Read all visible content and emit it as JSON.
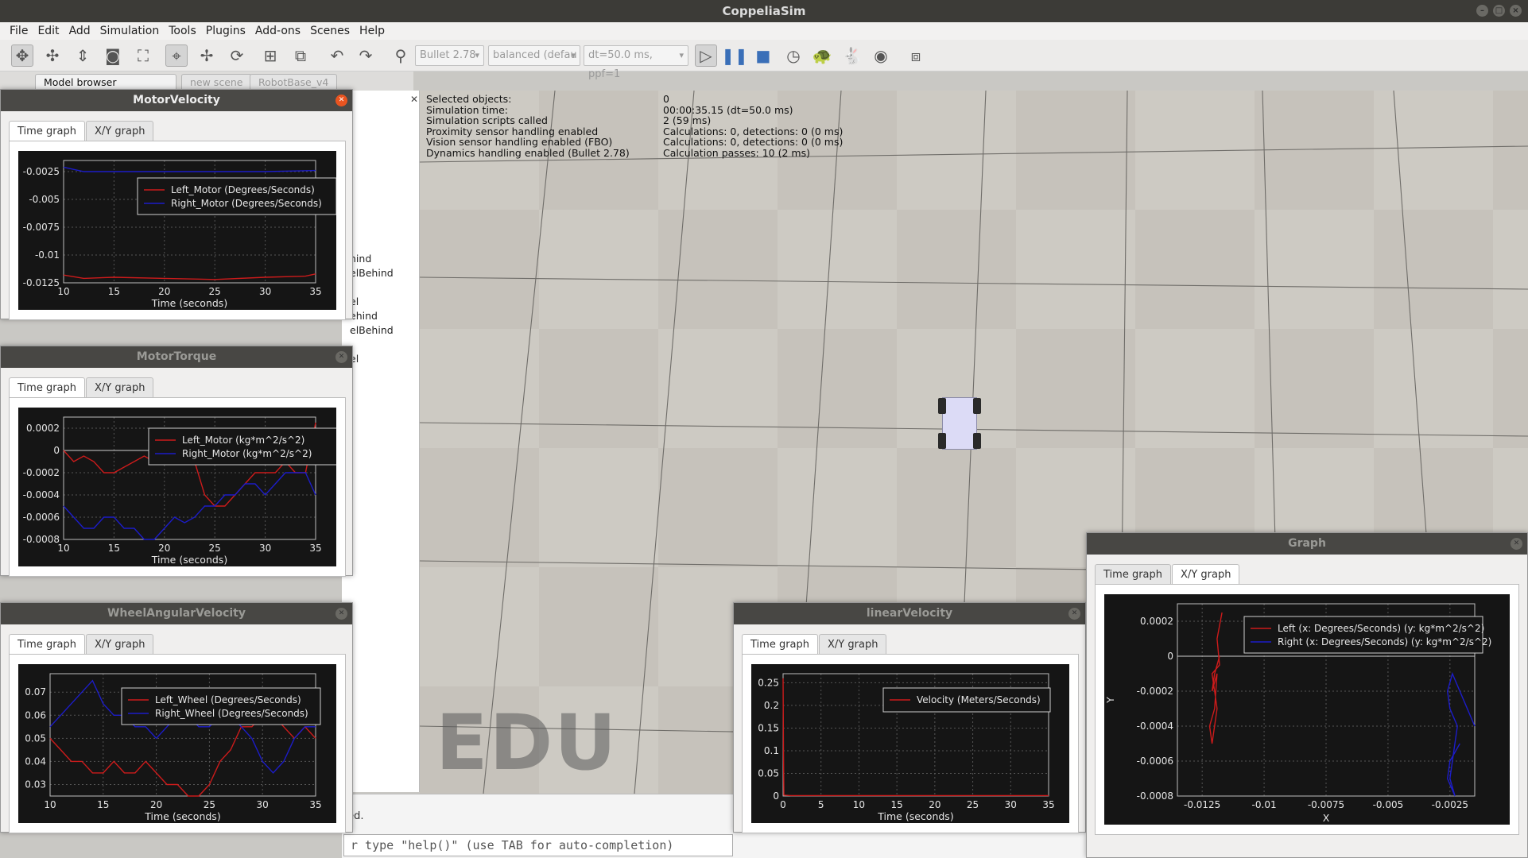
{
  "window": {
    "title": "CoppeliaSim"
  },
  "menu": [
    "File",
    "Edit",
    "Add",
    "Simulation",
    "Tools",
    "Plugins",
    "Add-ons",
    "Scenes",
    "Help"
  ],
  "toolbar": {
    "engine": "Bullet 2.78",
    "accuracy": "balanced (defau",
    "timestep": "dt=50.0 ms, ppf=1"
  },
  "tabs": {
    "model_browser": "Model browser",
    "new_scene": "new scene",
    "scene2": "RobotBase_v4"
  },
  "hierarchy": [
    "hind",
    "elBehind",
    "el",
    "ehind",
    "elBehind",
    "el"
  ],
  "sim_info": [
    {
      "k": "Selected objects:",
      "v": "0"
    },
    {
      "k": "Simulation time:",
      "v": "00:00:35.15 (dt=50.0 ms)"
    },
    {
      "k": "Simulation scripts called",
      "v": "2 (59 ms)"
    },
    {
      "k": "Proximity sensor handling enabled",
      "v": "Calculations: 0, detections: 0 (0 ms)"
    },
    {
      "k": "Vision sensor handling enabled (FBO)",
      "v": "Calculations: 0, detections: 0 (0 ms)"
    },
    {
      "k": "Dynamics handling enabled (Bullet 2.78)",
      "v": "Calculation passes: 10 (2 ms)"
    }
  ],
  "watermark": "EDU",
  "console": {
    "message": "ted.",
    "input": "r type \"help()\" (use TAB for auto-completion)"
  },
  "tab_labels": {
    "time": "Time graph",
    "xy": "X/Y graph"
  },
  "colors": {
    "left": "#cc1b1b",
    "right": "#1c1cc8"
  },
  "chart_data": [
    {
      "title": "MotorVelocity",
      "type": "line",
      "xlabel": "Time (seconds)",
      "ylabel": "",
      "xlim": [
        10,
        35
      ],
      "ylim": [
        -0.0125,
        -0.0015
      ],
      "xticks": [
        10,
        15,
        20,
        25,
        30,
        35
      ],
      "yticks": [
        -0.0025,
        -0.005,
        -0.0075,
        -0.01,
        -0.0125
      ],
      "ytick_labels": [
        "-0.0025",
        "-0.005",
        "-0.0075",
        "-0.01",
        "-0.0125"
      ],
      "series": [
        {
          "name": "Left_Motor (Degrees/Seconds)",
          "color": "red",
          "x": [
            10,
            12,
            15,
            20,
            25,
            30,
            34,
            35
          ],
          "y": [
            -0.0118,
            -0.0121,
            -0.012,
            -0.0121,
            -0.0122,
            -0.012,
            -0.0119,
            -0.0117
          ]
        },
        {
          "name": "Right_Motor (Degrees/Seconds)",
          "color": "blue",
          "x": [
            10,
            12,
            15,
            20,
            25,
            30,
            35
          ],
          "y": [
            -0.0021,
            -0.0025,
            -0.0025,
            -0.0025,
            -0.0025,
            -0.0025,
            -0.0024
          ]
        }
      ]
    },
    {
      "title": "MotorTorque",
      "type": "line",
      "xlabel": "Time (seconds)",
      "ylabel": "",
      "xlim": [
        10,
        35
      ],
      "ylim": [
        -0.0008,
        0.0003
      ],
      "xticks": [
        10,
        15,
        20,
        25,
        30,
        35
      ],
      "yticks": [
        0.0002,
        0,
        -0.0002,
        -0.0004,
        -0.0006,
        -0.0008
      ],
      "ytick_labels": [
        "0.0002",
        "0",
        "-0.0002",
        "-0.0004",
        "-0.0006",
        "-0.0008"
      ],
      "series": [
        {
          "name": "Left_Motor (kg*m^2/s^2)",
          "color": "red",
          "x": [
            10,
            11,
            12,
            13,
            14,
            15,
            16,
            17,
            18,
            19,
            20,
            21,
            22,
            23,
            24,
            25,
            26,
            27,
            28,
            29,
            30,
            31,
            32,
            33,
            34,
            35
          ],
          "y": [
            0,
            -0.0001,
            -5e-05,
            -0.0001,
            -0.0002,
            -0.0002,
            -0.00015,
            -0.0001,
            -5e-05,
            -0.0001,
            -0.0001,
            -5e-05,
            -0.0001,
            -0.0001,
            -0.0004,
            -0.0005,
            -0.0005,
            -0.0004,
            -0.0003,
            -0.0002,
            -0.0002,
            -0.0002,
            -0.0001,
            -0.0002,
            -0.0002,
            0.00025
          ]
        },
        {
          "name": "Right_Motor (kg*m^2/s^2)",
          "color": "blue",
          "x": [
            10,
            11,
            12,
            13,
            14,
            15,
            16,
            17,
            18,
            19,
            20,
            21,
            22,
            23,
            24,
            25,
            26,
            27,
            28,
            29,
            30,
            31,
            32,
            33,
            34,
            35
          ],
          "y": [
            -0.0005,
            -0.0006,
            -0.0007,
            -0.0007,
            -0.0006,
            -0.0006,
            -0.0007,
            -0.0007,
            -0.0008,
            -0.0008,
            -0.0007,
            -0.0006,
            -0.00065,
            -0.0006,
            -0.0005,
            -0.0005,
            -0.0004,
            -0.0004,
            -0.0003,
            -0.0003,
            -0.0004,
            -0.0003,
            -0.0002,
            -0.0002,
            -0.0002,
            -0.0004
          ]
        }
      ]
    },
    {
      "title": "WheelAngularVelocity",
      "type": "line",
      "xlabel": "Time (seconds)",
      "ylabel": "",
      "xlim": [
        10,
        35
      ],
      "ylim": [
        0.025,
        0.078
      ],
      "xticks": [
        10,
        15,
        20,
        25,
        30,
        35
      ],
      "yticks": [
        0.07,
        0.06,
        0.05,
        0.04,
        0.03
      ],
      "ytick_labels": [
        "0.07",
        "0.06",
        "0.05",
        "0.04",
        "0.03"
      ],
      "series": [
        {
          "name": "Left_Wheel (Degrees/Seconds)",
          "color": "red",
          "x": [
            10,
            11,
            12,
            13,
            14,
            15,
            16,
            17,
            18,
            19,
            20,
            21,
            22,
            23,
            24,
            25,
            26,
            27,
            28,
            29,
            30,
            31,
            32,
            33,
            34,
            35
          ],
          "y": [
            0.05,
            0.045,
            0.04,
            0.04,
            0.035,
            0.035,
            0.04,
            0.035,
            0.035,
            0.04,
            0.035,
            0.03,
            0.03,
            0.025,
            0.025,
            0.03,
            0.04,
            0.045,
            0.055,
            0.055,
            0.06,
            0.06,
            0.055,
            0.05,
            0.055,
            0.05
          ]
        },
        {
          "name": "Right_Wheel (Degrees/Seconds)",
          "color": "blue",
          "x": [
            10,
            11,
            12,
            13,
            14,
            15,
            16,
            17,
            18,
            19,
            20,
            21,
            22,
            23,
            24,
            25,
            26,
            27,
            28,
            29,
            30,
            31,
            32,
            33,
            34,
            35
          ],
          "y": [
            0.055,
            0.06,
            0.065,
            0.07,
            0.075,
            0.065,
            0.06,
            0.06,
            0.055,
            0.055,
            0.05,
            0.055,
            0.06,
            0.06,
            0.055,
            0.055,
            0.06,
            0.06,
            0.055,
            0.05,
            0.04,
            0.035,
            0.04,
            0.05,
            0.055,
            0.055
          ]
        }
      ]
    },
    {
      "title": "linearVelocity",
      "type": "line",
      "xlabel": "Time (seconds)",
      "ylabel": "",
      "xlim": [
        0,
        35
      ],
      "ylim": [
        0,
        0.27
      ],
      "xticks": [
        0,
        5,
        10,
        15,
        20,
        25,
        30,
        35
      ],
      "yticks": [
        0.25,
        0.2,
        0.15,
        0.1,
        0.05,
        0
      ],
      "ytick_labels": [
        "0.25",
        "0.2",
        "0.15",
        "0.1",
        "0.05",
        "0"
      ],
      "series": [
        {
          "name": "Velocity (Meters/Seconds)",
          "color": "red",
          "x": [
            0,
            0.05,
            0.1,
            1,
            10,
            20,
            30,
            35
          ],
          "y": [
            0.26,
            0.1,
            0.002,
            0.001,
            0.001,
            0.001,
            0.001,
            0.001
          ]
        }
      ]
    },
    {
      "title": "Graph",
      "type": "scatter",
      "xlabel": "X",
      "ylabel": "Y",
      "xlim": [
        -0.0135,
        -0.0015
      ],
      "ylim": [
        -0.0008,
        0.0003
      ],
      "xticks": [
        -0.0125,
        -0.01,
        -0.0075,
        -0.005,
        -0.0025
      ],
      "yticks": [
        0.0002,
        0,
        -0.0002,
        -0.0004,
        -0.0006,
        -0.0008
      ],
      "xtick_labels": [
        "-0.0125",
        "-0.01",
        "-0.0075",
        "-0.005",
        "-0.0025"
      ],
      "ytick_labels": [
        "0.0002",
        "0",
        "-0.0002",
        "-0.0004",
        "-0.0006",
        "-0.0008"
      ],
      "series": [
        {
          "name": "Left (x: Degrees/Seconds) (y: kg*m^2/s^2)",
          "color": "red",
          "x": [
            -0.0118,
            -0.012,
            -0.0121,
            -0.0119,
            -0.012,
            -0.0122,
            -0.0121,
            -0.0119,
            -0.012,
            -0.0121,
            -0.0118,
            -0.0119,
            -0.0117
          ],
          "y": [
            0,
            -0.0001,
            -0.0002,
            -0.0001,
            -0.0003,
            -0.0004,
            -0.0005,
            -0.0003,
            -0.0002,
            -0.0001,
            -5e-05,
            0.0001,
            0.00025
          ]
        },
        {
          "name": "Right (x: Degrees/Seconds) (y: kg*m^2/s^2)",
          "color": "blue",
          "x": [
            -0.0021,
            -0.0025,
            -0.0026,
            -0.0023,
            -0.0025,
            -0.0024,
            -0.0022,
            -0.0025,
            -0.0026,
            -0.0024,
            -0.0015
          ],
          "y": [
            -0.0005,
            -0.0006,
            -0.0007,
            -0.0008,
            -0.0007,
            -0.0006,
            -0.0004,
            -0.0003,
            -0.0002,
            -0.0001,
            -0.0004
          ]
        }
      ]
    }
  ]
}
